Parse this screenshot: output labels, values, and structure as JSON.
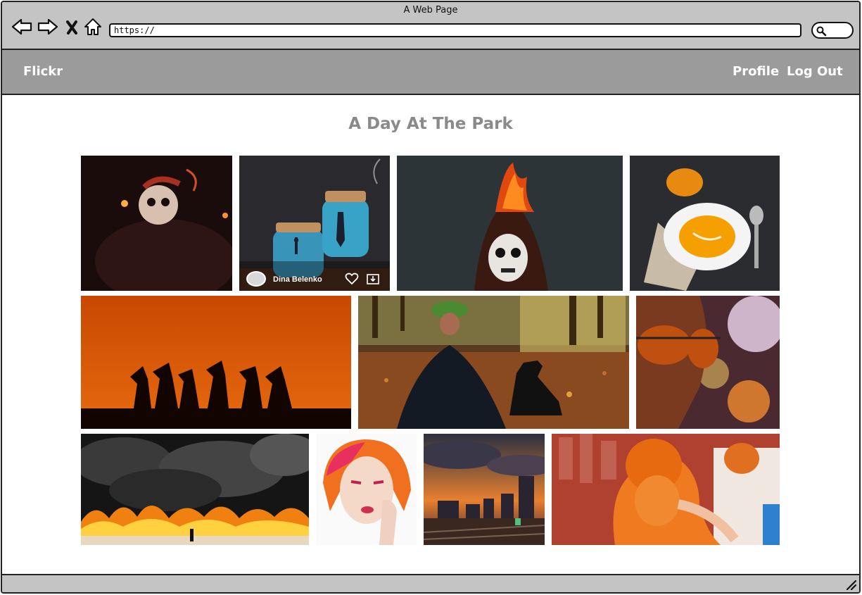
{
  "window": {
    "title": "A Web Page"
  },
  "browser": {
    "url": "https://",
    "icons": [
      "back-arrow-icon",
      "forward-arrow-icon",
      "close-icon",
      "home-icon",
      "search-icon"
    ]
  },
  "header": {
    "brand": "Flickr",
    "nav": {
      "profile": "Profile",
      "logout": "Log Out"
    }
  },
  "album": {
    "title": "A Day At The Park",
    "hover_overlay": {
      "author": "Dina Belenko",
      "icons": [
        "heart-icon",
        "download-icon"
      ]
    }
  },
  "colors": {
    "chrome": "#c4c4c4",
    "header": "#9b9b9b",
    "title": "#8a8a8a"
  }
}
